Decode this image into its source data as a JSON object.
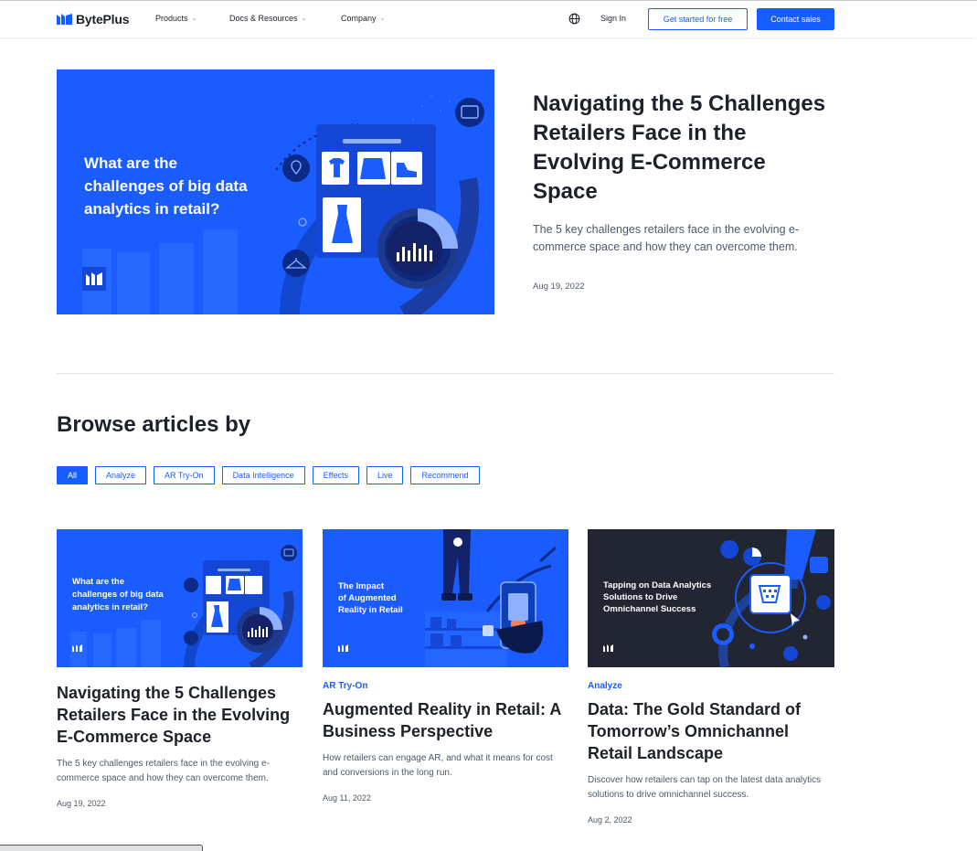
{
  "header": {
    "brand": "BytePlus",
    "nav": [
      {
        "label": "Products"
      },
      {
        "label": "Docs & Resources"
      },
      {
        "label": "Company"
      }
    ],
    "sign_in": "Sign In",
    "get_started": "Get started for free",
    "contact_sales": "Contact sales"
  },
  "featured": {
    "image_text": [
      "What are the",
      "challenges of big data",
      "analytics in retail?"
    ],
    "title": "Navigating the 5 Challenges Retailers Face in the Evolving E-Commerce Space",
    "description": "The 5 key challenges retailers face in the evolving e-commerce space and how they can overcome them.",
    "date": "Aug 19, 2022"
  },
  "browse": {
    "title": "Browse articles by",
    "filters": [
      "All",
      "Analyze",
      "AR Try-On",
      "Data Intelligence",
      "Effects",
      "Live",
      "Recommend"
    ],
    "active_filter": "All"
  },
  "cards": [
    {
      "image_text": [
        "What are the",
        "challenges of big data",
        "analytics in retail?"
      ],
      "tag": "",
      "title": "Navigating the 5 Challenges Retailers Face in the Evolving E-Commerce Space",
      "description": "The 5 key challenges retailers face in the evolving e-commerce space and how they can overcome them.",
      "date": "Aug 19, 2022"
    },
    {
      "image_text": [
        "The Impact",
        "of Augmented",
        "Reality in Retail"
      ],
      "tag": "AR Try-On",
      "title": "Augmented Reality in Retail: A Business Perspective",
      "description": "How retailers can engage AR, and what it means for cost and conversions in the long run.",
      "date": "Aug 11, 2022"
    },
    {
      "image_text": [
        "Tapping on Data Analytics",
        "Solutions to Drive",
        "Omnichannel Success"
      ],
      "tag": "Analyze",
      "title": "Data: The Gold Standard of Tomorrow’s Omnichannel Retail Landscape",
      "description": "Discover how retailers can tap on the latest data analytics solutions to drive omnichannel success.",
      "date": "Aug 2, 2022"
    }
  ],
  "colors": {
    "brand_blue": "#165dff",
    "image_blue": "#1a5cff",
    "image_dark": "#222632",
    "text_primary": "#1d2129",
    "text_secondary": "#4e5969"
  }
}
